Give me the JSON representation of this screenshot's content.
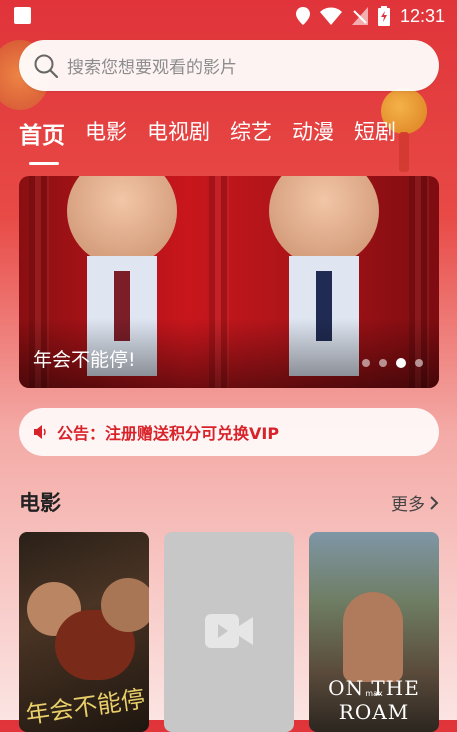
{
  "status_bar": {
    "time": "12:31"
  },
  "search": {
    "placeholder": "搜索您想要观看的影片"
  },
  "tabs": [
    {
      "label": "首页",
      "active": true
    },
    {
      "label": "电影"
    },
    {
      "label": "电视剧"
    },
    {
      "label": "综艺"
    },
    {
      "label": "动漫"
    },
    {
      "label": "短剧"
    }
  ],
  "banner": {
    "title": "年会不能停!",
    "dots_total": 4,
    "dots_active": 3
  },
  "notice": {
    "text": "公告：注册赠送积分可兑换VIP"
  },
  "section": {
    "title": "电影",
    "more_label": "更多"
  },
  "posters": [
    {
      "title_art": "年会不能停",
      "type": "image"
    },
    {
      "type": "placeholder",
      "icon": "video-camera-icon"
    },
    {
      "title": "ON THE ROAM",
      "tag": "max"
    }
  ],
  "colors": {
    "accent": "#d8232a",
    "header_gradient_top": "#e0343a"
  }
}
